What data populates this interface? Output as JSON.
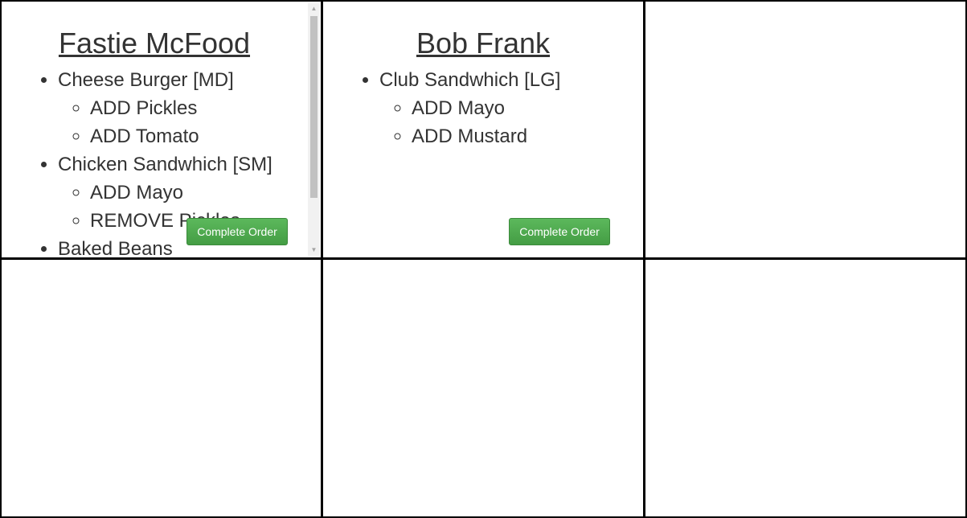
{
  "orders": [
    {
      "customer": "Fastie McFood",
      "items": [
        {
          "name": "Cheese Burger [MD]",
          "mods": [
            "ADD Pickles",
            "ADD Tomato"
          ]
        },
        {
          "name": "Chicken Sandwhich [SM]",
          "mods": [
            "ADD Mayo",
            "REMOVE Pickles"
          ]
        },
        {
          "name": "Baked Beans",
          "mods": []
        }
      ],
      "button_label": "Complete Order"
    },
    {
      "customer": "Bob Frank",
      "items": [
        {
          "name": "Club Sandwhich [LG]",
          "mods": [
            "ADD Mayo",
            "ADD Mustard"
          ]
        }
      ],
      "button_label": "Complete Order"
    }
  ],
  "colors": {
    "button": "#4cae4c",
    "grid_lines": "#000000",
    "text": "#333333"
  },
  "icons": {
    "scroll_up": "triangle-up-icon",
    "scroll_down": "triangle-down-icon"
  }
}
